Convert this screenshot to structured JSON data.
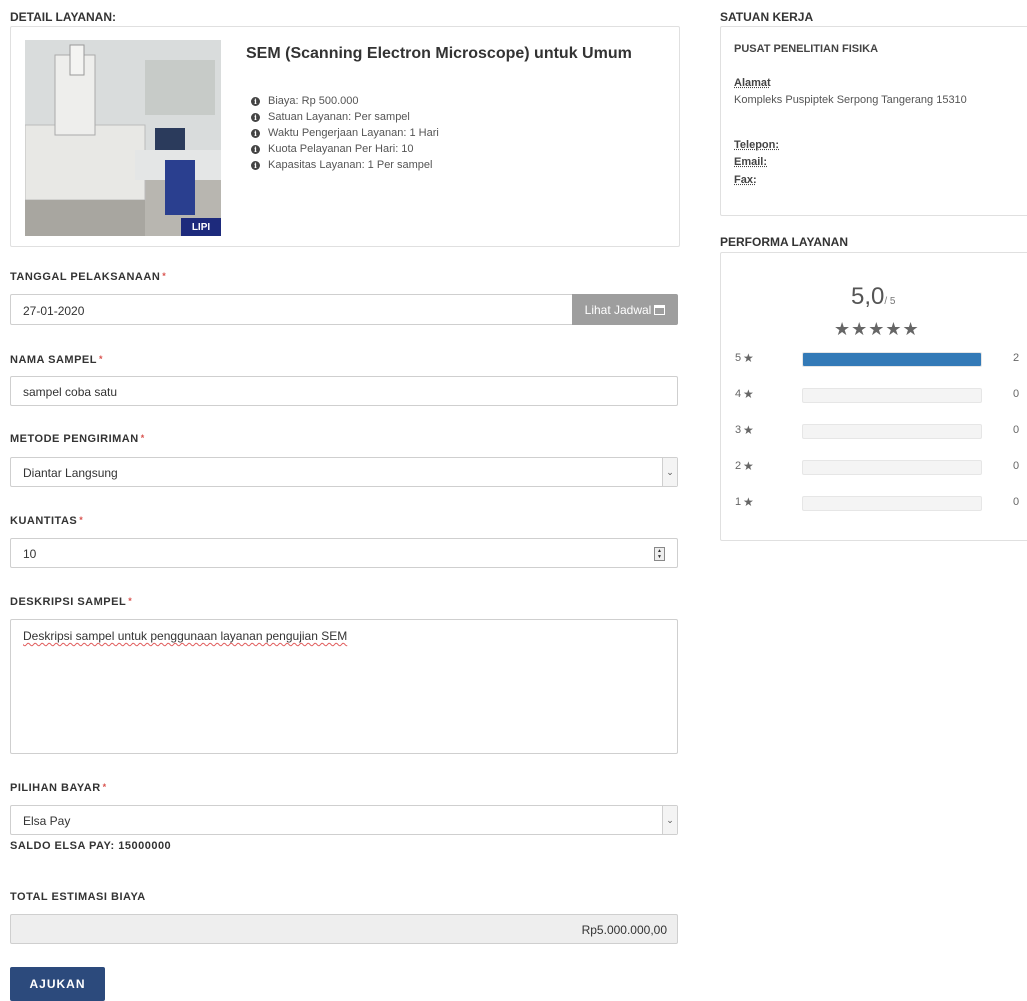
{
  "detail": {
    "section_title": "DETAIL LAYANAN:",
    "service_title": "SEM (Scanning Electron Microscope) untuk Umum",
    "image_badge": "LIPI",
    "bullets": [
      "Biaya: Rp 500.000",
      "Satuan Layanan: Per sampel",
      "Waktu Pengerjaan Layanan: 1 Hari",
      "Kuota Pelayanan Per Hari: 10",
      "Kapasitas Layanan: 1 Per sampel"
    ]
  },
  "form": {
    "tanggal_label": "TANGGAL PELAKSANAAN",
    "tanggal_value": "27-01-2020",
    "lihat_jadwal": "Lihat Jadwal",
    "nama_label": "NAMA SAMPEL",
    "nama_value": "sampel coba satu",
    "metode_label": "METODE PENGIRIMAN",
    "metode_value": "Diantar Langsung",
    "kuantitas_label": "KUANTITAS",
    "kuantitas_value": "10",
    "deskripsi_label": "DESKRIPSI SAMPEL",
    "deskripsi_value": "Deskripsi sampel untuk penggunaan layanan pengujian SEM",
    "bayar_label": "PILIHAN BAYAR",
    "bayar_value": "Elsa Pay",
    "saldo_text": "SALDO ELSA PAY: 15000000",
    "total_label": "TOTAL ESTIMASI BIAYA",
    "total_value": "Rp5.000.000,00",
    "submit": "AJUKAN",
    "required_mark": "*"
  },
  "satuan": {
    "section_title": "SATUAN KERJA",
    "name": "PUSAT PENELITIAN FISIKA",
    "alamat_label": "Alamat",
    "alamat_value": "Kompleks Puspiptek Serpong Tangerang 15310",
    "telepon_label": "Telepon:",
    "email_label": "Email:",
    "fax_label": "Fax:"
  },
  "performa": {
    "section_title": "PERFORMA LAYANAN",
    "score": "5,0",
    "score_max": "/ 5",
    "stars": "★★★★★",
    "rows": [
      {
        "star": "5",
        "count": "2",
        "fraction": 1.0
      },
      {
        "star": "4",
        "count": "0",
        "fraction": 0
      },
      {
        "star": "3",
        "count": "0",
        "fraction": 0
      },
      {
        "star": "2",
        "count": "0",
        "fraction": 0
      },
      {
        "star": "1",
        "count": "0",
        "fraction": 0
      }
    ]
  },
  "colors": {
    "accent": "#337ab7",
    "submit_bg": "#2c4a7c",
    "button_gray": "#9e9e9e"
  }
}
